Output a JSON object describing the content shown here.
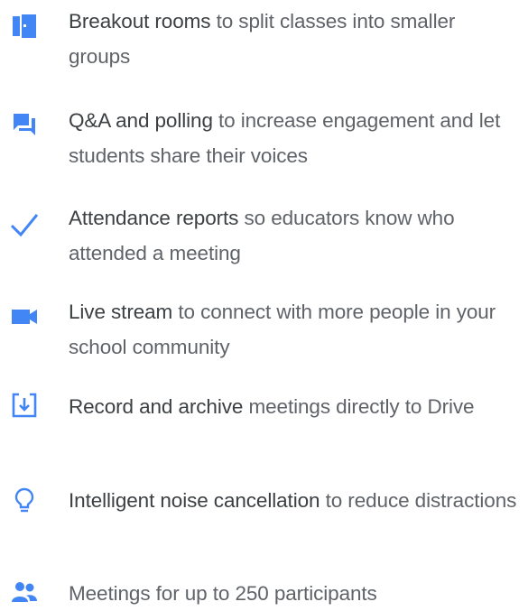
{
  "accent_color": "#4285f4",
  "features": [
    {
      "icon": "door-icon",
      "title": "Breakout rooms",
      "description": "to split classes into smaller groups"
    },
    {
      "icon": "chat-icon",
      "title": "Q&A and polling",
      "description": "to increase engagement and let students share their voices"
    },
    {
      "icon": "checkmark-icon",
      "title": "Attendance reports",
      "description": "so educators know who attended a meeting"
    },
    {
      "icon": "video-camera-icon",
      "title": "Live stream",
      "description": "to connect with more people in your school community"
    },
    {
      "icon": "download-icon",
      "title": "Record and archive",
      "description": "meetings directly to Drive"
    },
    {
      "icon": "lightbulb-icon",
      "title": "Intelligent noise cancellation",
      "description": "to reduce distractions"
    },
    {
      "icon": "people-icon",
      "title": "",
      "description": "Meetings for up to 250 participants"
    }
  ]
}
